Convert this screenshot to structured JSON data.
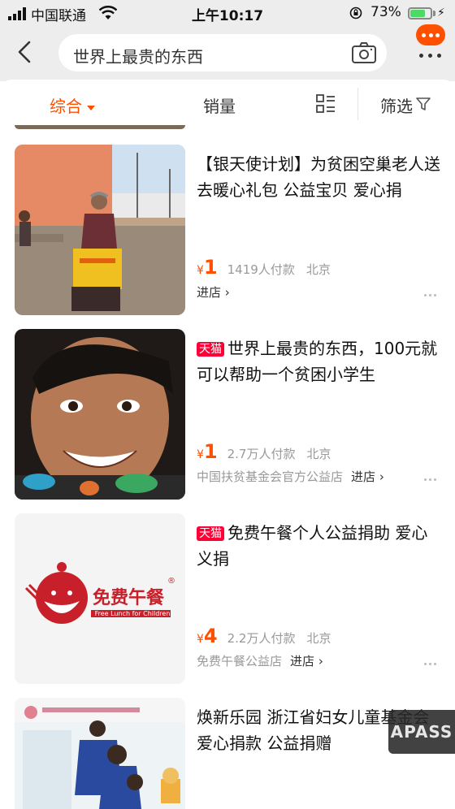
{
  "status_bar": {
    "carrier": "中国联通",
    "time": "上午10:17",
    "battery_percent": "73%",
    "battery_level": 0.73
  },
  "search": {
    "query": "世界上最贵的东西",
    "back_icon": "chevron-left-icon",
    "camera_icon": "camera-icon",
    "more_icon": "more-dots-icon"
  },
  "filters": {
    "tabs": [
      "综合",
      "销量",
      "筛选"
    ],
    "active_tab": "综合",
    "accent_color": "#ff5000"
  },
  "products": [
    {
      "title": "【银天使计划】为贫困空巢老人送去暖心礼包 公益宝贝 爱心捐",
      "tmall": false,
      "currency": "¥",
      "price": "1",
      "sales": "1419人付款",
      "location": "北京",
      "shop": "",
      "enter": "进店"
    },
    {
      "title": "世界上最贵的东西，100元就可以帮助一个贫困小学生",
      "tmall": true,
      "badge": "天猫",
      "currency": "¥",
      "price": "1",
      "sales": "2.7万人付款",
      "location": "北京",
      "shop": "中国扶贫基金会官方公益店",
      "enter": "进店"
    },
    {
      "title": "免费午餐个人公益捐助 爱心义捐",
      "tmall": true,
      "badge": "天猫",
      "currency": "¥",
      "price": "4",
      "sales": "2.2万人付款",
      "location": "北京",
      "shop": "免费午餐公益店",
      "enter": "进店",
      "logo_text": "免费午餐",
      "logo_subtext": "Free Lunch for Children"
    },
    {
      "title": "焕新乐园 浙江省妇女儿童基金会 爱心捐款 公益捐赠",
      "tmall": false
    }
  ],
  "watermark": "APASS",
  "colors": {
    "accent": "#ff5000",
    "tmall_red": "#ff0036",
    "muted": "#999999"
  }
}
